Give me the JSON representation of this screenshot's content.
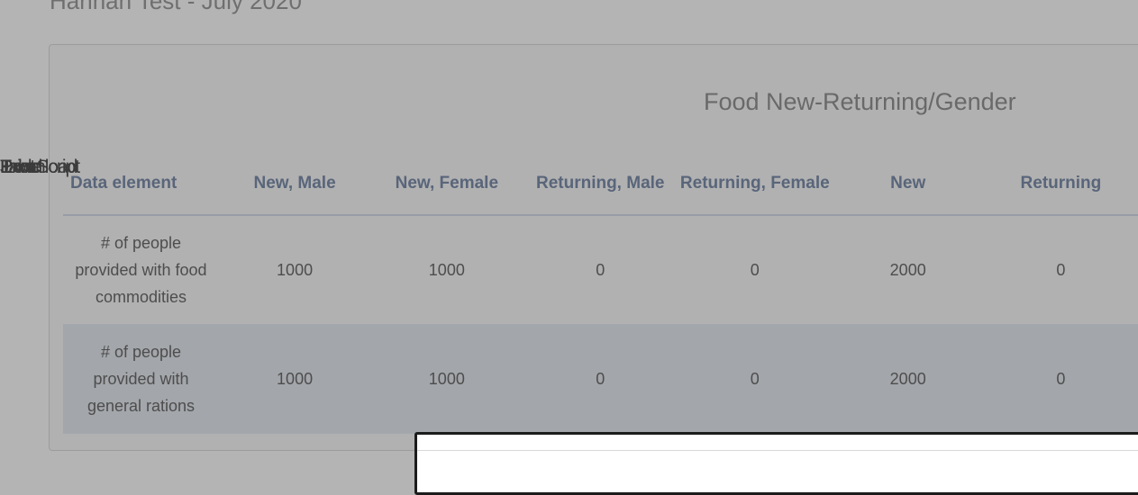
{
  "page": {
    "title": "Hannah Test - July 2020"
  },
  "report": {
    "title": "Food New-Returning/Gender"
  },
  "overlap": {
    "texts": [
      "JavaScript",
      "Excel",
      "Table",
      "Print",
      "Download"
    ]
  },
  "table": {
    "headers": [
      "Data element",
      "New, Male",
      "New, Female",
      "Returning, Male",
      "Returning, Female",
      "New",
      "Returning"
    ],
    "rows": [
      [
        "# of people provided with food commodities",
        "1000",
        "1000",
        "0",
        "0",
        "2000",
        "0"
      ],
      [
        "# of people provided with general rations",
        "1000",
        "1000",
        "0",
        "0",
        "2000",
        "0"
      ]
    ]
  },
  "colors": {
    "overlay": "#b4b4b4",
    "header_text": "#59657a",
    "alt_row": "#a3a6aa"
  }
}
